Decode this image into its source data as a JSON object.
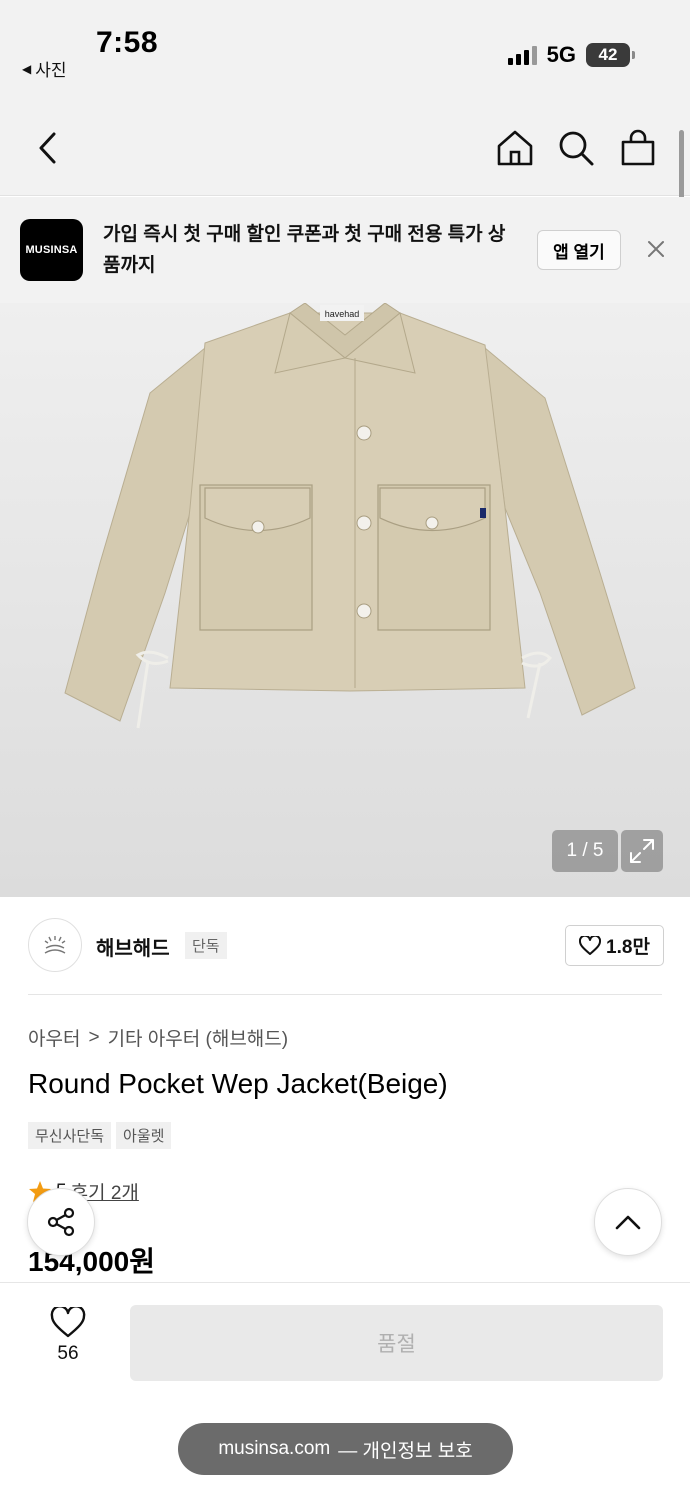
{
  "status_bar": {
    "time": "7:58",
    "back_app": "사진",
    "network": "5G",
    "battery": "42"
  },
  "nav": {
    "icons": [
      "back-icon",
      "home-icon",
      "search-icon",
      "cart-icon"
    ]
  },
  "banner": {
    "logo_text": "MUSINSA",
    "text": "가입 즉시 첫 구매 할인 쿠폰과 첫 구매 전용 특가 상품까지",
    "open_app_label": "앱 열기"
  },
  "gallery": {
    "counter": "1 / 5",
    "label_tag": "havehad"
  },
  "brand": {
    "name": "해브해드",
    "exclusive_tag": "단독",
    "likes": "1.8만"
  },
  "breadcrumb": {
    "category": "아우터",
    "separator": ">",
    "subcategory": "기타 아우터 (해브해드)"
  },
  "product": {
    "title": "Round Pocket Wep Jacket(Beige)",
    "tags": [
      "무신사단독",
      "아울렛"
    ],
    "rating": "5",
    "reviews": "후기 2개",
    "price": "154,000원"
  },
  "bottom": {
    "wish_count": "56",
    "soldout_label": "품절",
    "url": "musinsa.com",
    "url_suffix": "— 개인정보 보호"
  },
  "colors": {
    "accent_star": "#f39c12",
    "jacket": "#d2c8ae"
  }
}
